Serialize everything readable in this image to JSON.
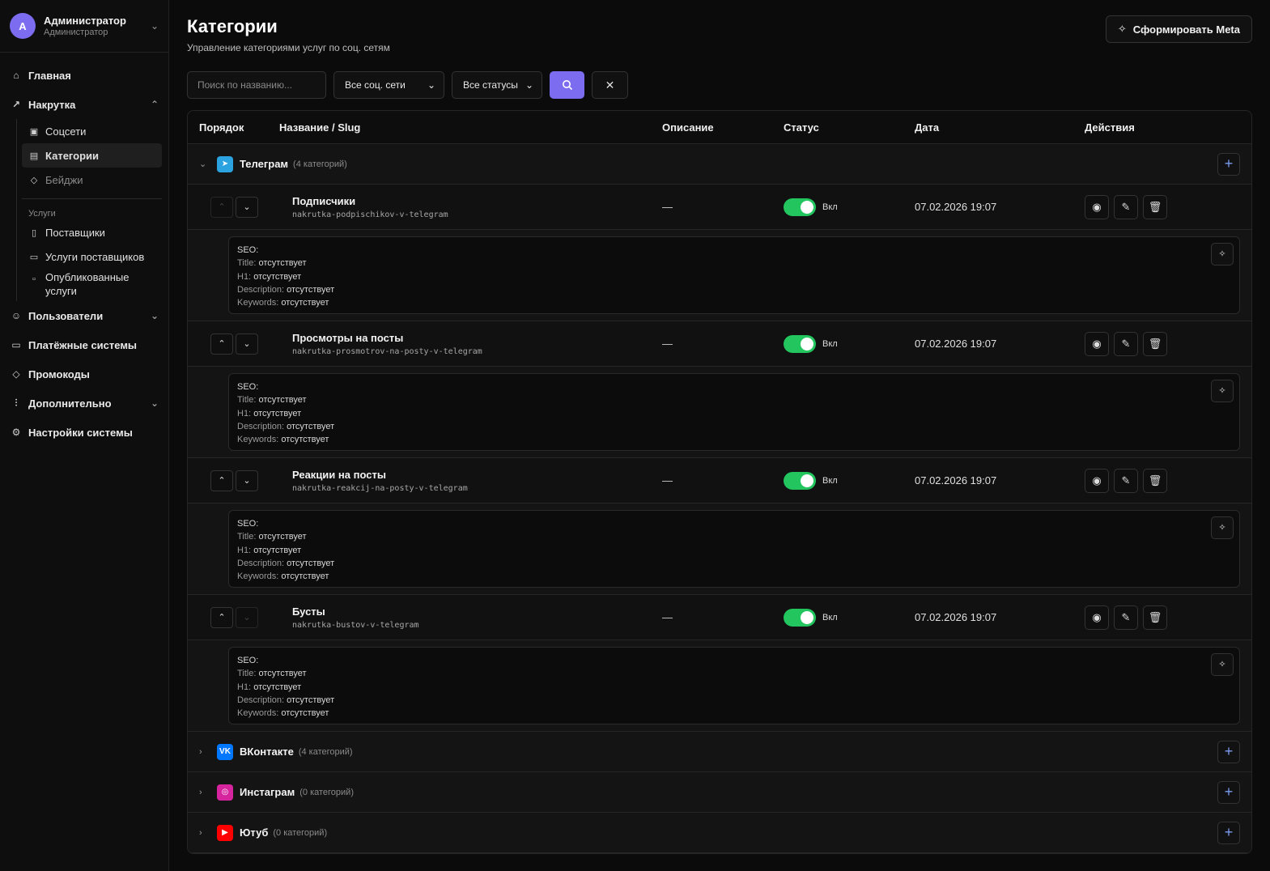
{
  "user": {
    "initial": "A",
    "name": "Администратор",
    "role": "Администратор"
  },
  "sidebar": {
    "home": "Главная",
    "nakrutka": "Накрутка",
    "sub": {
      "socials": "Соцсети",
      "categories": "Категории",
      "badges": "Бейджи"
    },
    "services_heading": "Услуги",
    "services": {
      "suppliers": "Поставщики",
      "supplier_services": "Услуги поставщиков",
      "published_1": "Опубликованные",
      "published_2": "услуги"
    },
    "users": "Пользователи",
    "payments": "Платёжные системы",
    "promocodes": "Промокоды",
    "extra": "Дополнительно",
    "settings": "Настройки системы"
  },
  "header": {
    "title": "Категории",
    "subtitle": "Управление категориями услуг по соц. сетям",
    "meta_button": "Сформировать Meta"
  },
  "filters": {
    "search_placeholder": "Поиск по названию...",
    "network_select": "Все соц. сети",
    "status_select": "Все статусы"
  },
  "table": {
    "columns": {
      "order": "Порядок",
      "name": "Название / Slug",
      "description": "Описание",
      "status": "Статус",
      "date": "Дата",
      "actions": "Действия"
    },
    "groups": [
      {
        "name": "Телеграм",
        "count": "(4 категорий)",
        "color": "#2aa3e0"
      },
      {
        "name": "ВКонтакте",
        "count": "(4 категорий)",
        "color": "#0077ff"
      },
      {
        "name": "Инстаграм",
        "count": "(0 категорий)",
        "color": "#d6249f"
      },
      {
        "name": "Ютуб",
        "count": "(0 категорий)",
        "color": "#ff0000"
      }
    ],
    "categories": [
      {
        "name": "Подписчики",
        "slug": "nakrutka-podpischikov-v-telegram",
        "description": "—",
        "status": "Вкл",
        "date": "07.02.2026 19:07"
      },
      {
        "name": "Просмотры на посты",
        "slug": "nakrutka-prosmotrov-na-posty-v-telegram",
        "description": "—",
        "status": "Вкл",
        "date": "07.02.2026 19:07"
      },
      {
        "name": "Реакции на посты",
        "slug": "nakrutka-reakcij-na-posty-v-telegram",
        "description": "—",
        "status": "Вкл",
        "date": "07.02.2026 19:07"
      },
      {
        "name": "Бусты",
        "slug": "nakrutka-bustov-v-telegram",
        "description": "—",
        "status": "Вкл",
        "date": "07.02.2026 19:07"
      }
    ],
    "seo": {
      "heading": "SEO:",
      "title_label": "Title:",
      "h1_label": "H1:",
      "desc_label": "Description:",
      "keywords_label": "Keywords:",
      "missing": "отсутствует"
    }
  },
  "colors": {
    "accent": "#7c6cf0",
    "toggle_on": "#22c55e"
  }
}
